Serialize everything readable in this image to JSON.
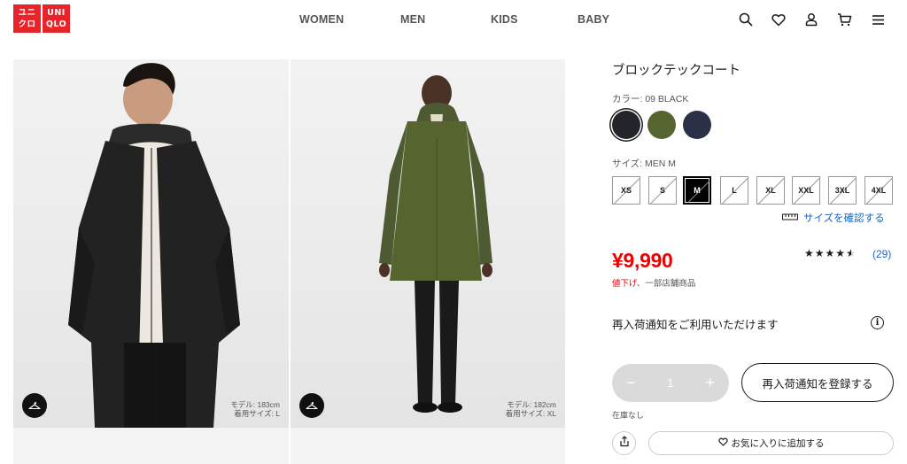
{
  "brand": {
    "logo_line1": "ユニ",
    "logo_line2": "クロ",
    "logo_line3": "UNI",
    "logo_line4": "QLO",
    "color": "#e8242a"
  },
  "nav": {
    "items": [
      "WOMEN",
      "MEN",
      "KIDS",
      "BABY"
    ]
  },
  "header_icons": [
    "search-icon",
    "heart-icon",
    "user-icon",
    "cart-icon",
    "menu-icon"
  ],
  "gallery": [
    {
      "model_label": "モデル: 183cm",
      "size_label": "着用サイズ: L",
      "color": "#1c1c1c"
    },
    {
      "model_label": "モデル: 182cm",
      "size_label": "着用サイズ: XL",
      "color": "#4d5a32"
    }
  ],
  "product": {
    "title": "ブロックテックコート",
    "color_label": "カラー: 09 BLACK",
    "colors": [
      {
        "name": "black",
        "hex": "#23252a",
        "selected": true
      },
      {
        "name": "olive",
        "hex": "#56652f",
        "selected": false
      },
      {
        "name": "navy",
        "hex": "#2a3147",
        "selected": false
      }
    ],
    "size_label": "サイズ: MEN M",
    "sizes": [
      {
        "label": "XS",
        "selected": false
      },
      {
        "label": "S",
        "selected": false
      },
      {
        "label": "M",
        "selected": true
      },
      {
        "label": "L",
        "selected": false
      },
      {
        "label": "XL",
        "selected": false
      },
      {
        "label": "XXL",
        "selected": false
      },
      {
        "label": "3XL",
        "selected": false
      },
      {
        "label": "4XL",
        "selected": false
      }
    ],
    "size_check_label": "サイズを確認する",
    "price": "¥9,990",
    "discount_red": "値下げ",
    "discount_rest": "、一部店舗商品",
    "rating_stars": "★★★★★",
    "rating_value": 4.5,
    "review_count": "(29)",
    "restock_notice": "再入荷通知をご利用いただけます",
    "info_glyph": "i",
    "quantity": "1",
    "qty_minus": "−",
    "qty_plus": "+",
    "register_label": "再入荷通知を登録する",
    "stock_status": "在庫なし",
    "favorite_label": "お気に入りに追加する"
  }
}
